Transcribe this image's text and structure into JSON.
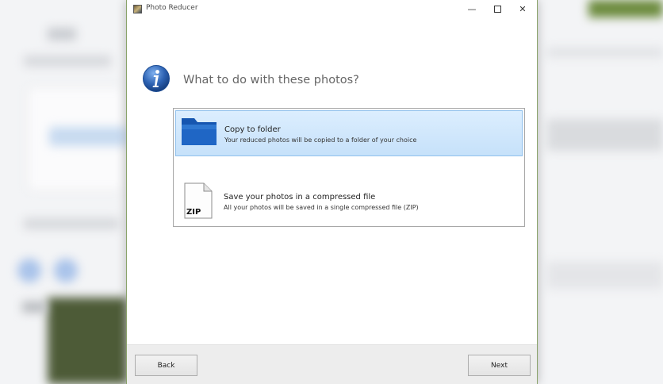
{
  "window": {
    "title": "Photo Reducer",
    "controls": {
      "minimize": "—",
      "close": "✕"
    }
  },
  "heading": "What to do with these photos?",
  "options": [
    {
      "title": "Copy to folder",
      "description": "Your reduced photos will be copied to a folder of your choice",
      "icon": "folder-icon",
      "selected": true
    },
    {
      "title": "Save your photos in a compressed file",
      "description": "All your photos will be saved in a single compressed file (ZIP)",
      "icon": "zip-file-icon",
      "icon_label": "ZIP",
      "selected": false
    }
  ],
  "buttons": {
    "back": "Back",
    "next": "Next"
  },
  "colors": {
    "selection": "#cce4fb",
    "selection_border": "#90c0ec",
    "info_icon": "#2d62b3",
    "folder": "#1f66c5"
  }
}
